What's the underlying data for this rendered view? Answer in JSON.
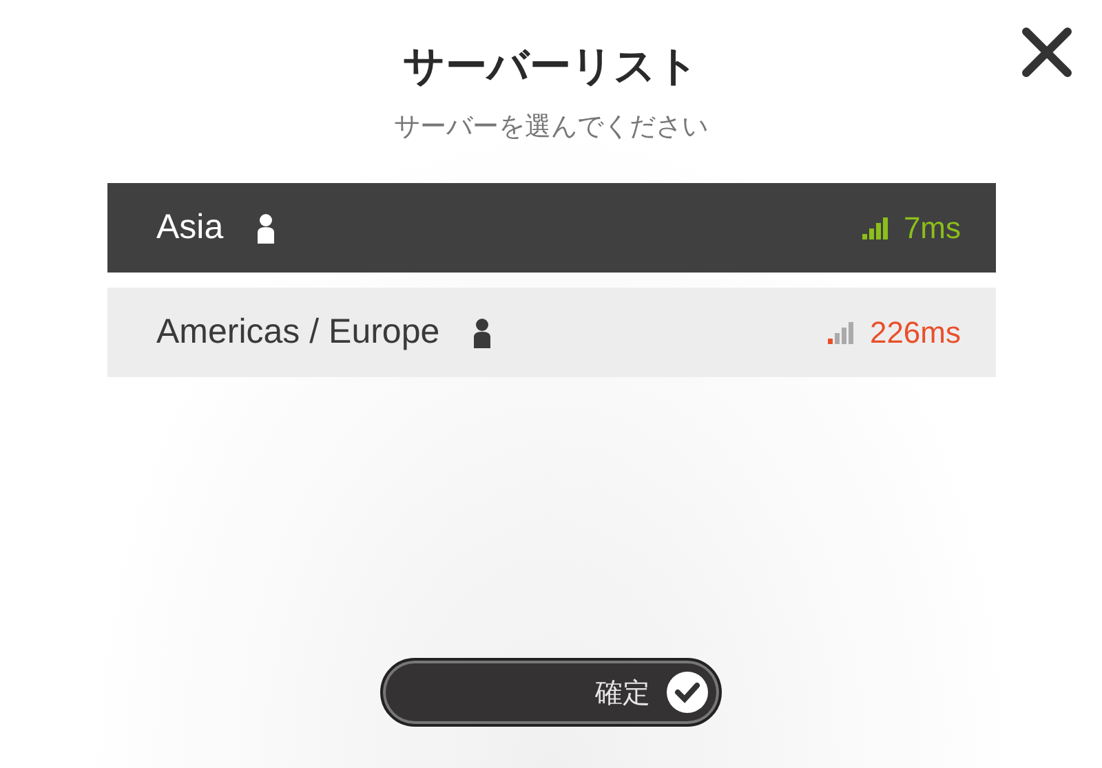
{
  "dialog": {
    "title": "サーバーリスト",
    "subtitle": "サーバーを選んでください"
  },
  "servers": [
    {
      "name": "Asia",
      "selected": true,
      "kind": "good",
      "latency": "7ms",
      "color": "#8cbf1a"
    },
    {
      "name": "Americas / Europe",
      "selected": false,
      "kind": "poor",
      "latency": "226ms",
      "color": "#e8502a"
    }
  ],
  "confirm_button": {
    "label": "確定"
  }
}
